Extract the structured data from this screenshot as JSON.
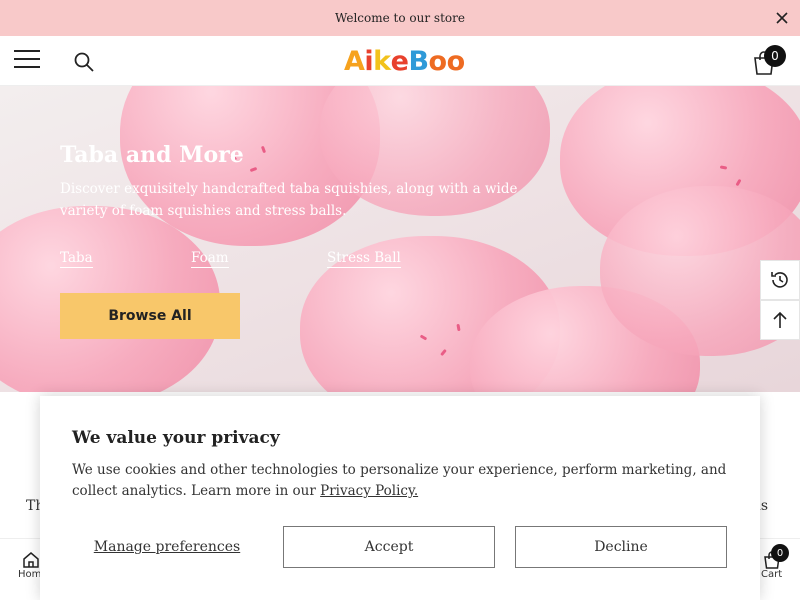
{
  "announcement": {
    "text": "Welcome to our store"
  },
  "header": {
    "logo_parts": [
      "A",
      "i",
      "k",
      "e",
      "B",
      "oo"
    ],
    "cart_count": "0"
  },
  "hero": {
    "title": "Taba and More",
    "description": "Discover exquisitely handcrafted taba squishies, along with a wide variety of foam squishies and stress balls.",
    "links": [
      "Taba",
      "Foam",
      "Stress Ball"
    ],
    "button_label": "Browse All"
  },
  "below_hero": {
    "left_text": "Th",
    "right_text": "als"
  },
  "bottom_bar": {
    "home_label": "Hom",
    "cart_label": "Cart",
    "cart_count": "0"
  },
  "cookie_banner": {
    "title": "We value your privacy",
    "text": "We use cookies and other technologies to personalize your experience, perform marketing, and collect analytics. Learn more in our ",
    "link_text": "Privacy Policy.",
    "manage_label": "Manage preferences",
    "accept_label": "Accept",
    "decline_label": "Decline"
  },
  "colors": {
    "announcement_bg": "#f8c9c9",
    "button_bg": "#f8c76a",
    "hero_pink": "#f7a9bd"
  },
  "icons": [
    "close-icon",
    "hamburger-icon",
    "search-icon",
    "cart-icon",
    "recent-history-icon",
    "arrow-up-icon",
    "home-icon"
  ]
}
